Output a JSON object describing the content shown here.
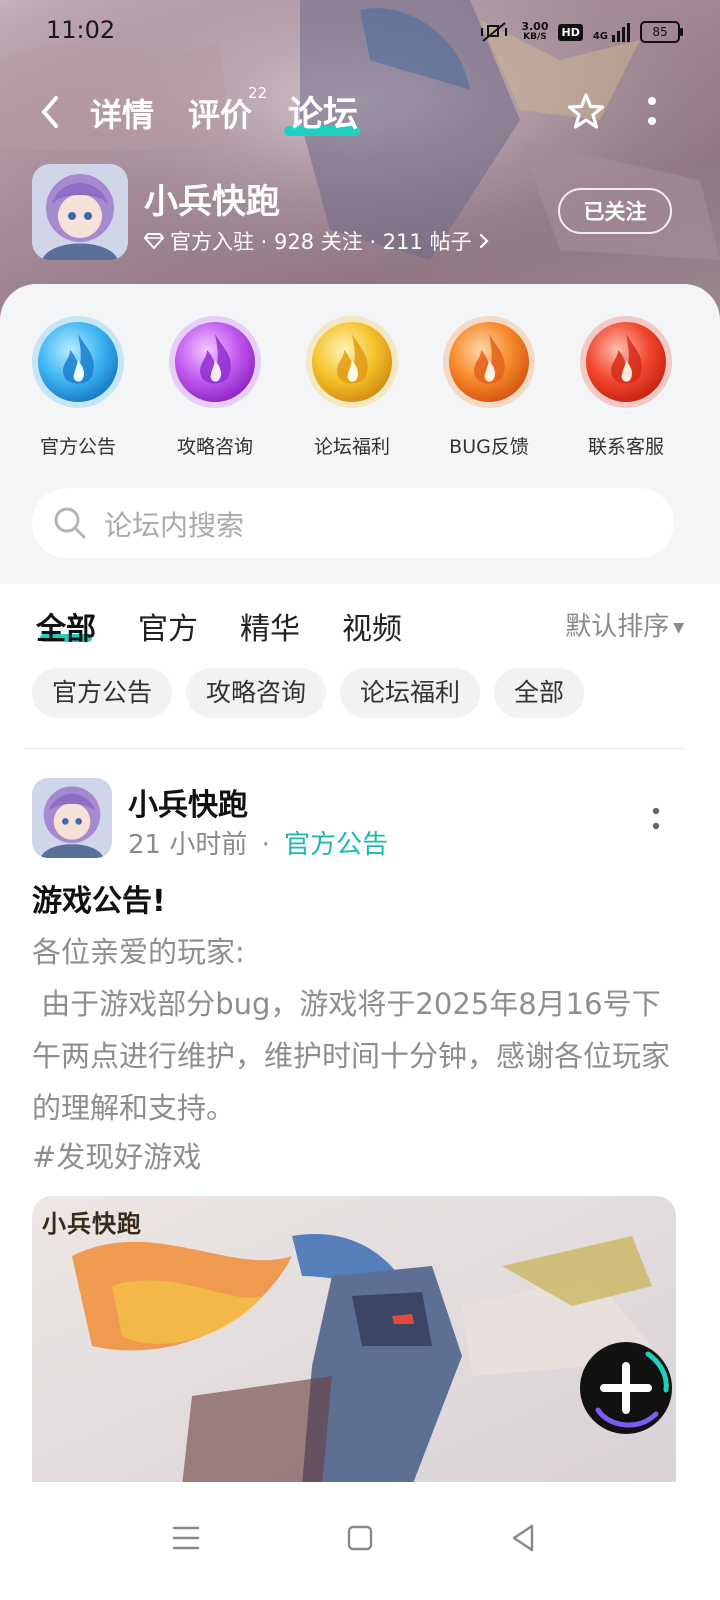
{
  "status_bar": {
    "time": "11:02",
    "net_speed_value": "3.00",
    "net_speed_unit": "KB/S",
    "hd_badge": "HD",
    "network": "4G",
    "battery": "85"
  },
  "nav": {
    "tabs": [
      {
        "label": "详情"
      },
      {
        "label": "评价",
        "badge": "22"
      },
      {
        "label": "论坛",
        "active": true
      }
    ]
  },
  "game": {
    "name": "小兵快跑",
    "meta": "官方入驻 · 928 关注 · 211 帖子",
    "follow_button": "已关注"
  },
  "quick_entries": [
    {
      "label": "官方公告",
      "color": "#3fb6f2"
    },
    {
      "label": "攻略咨询",
      "color": "#c25af0"
    },
    {
      "label": "论坛福利",
      "color": "#f5c22a"
    },
    {
      "label": "BUG反馈",
      "color": "#f7892b"
    },
    {
      "label": "联系客服",
      "color": "#f2472f"
    }
  ],
  "search": {
    "placeholder": "论坛内搜索"
  },
  "filter_tabs": [
    {
      "label": "全部",
      "active": true
    },
    {
      "label": "官方"
    },
    {
      "label": "精华"
    },
    {
      "label": "视频"
    }
  ],
  "sort_label": "默认排序",
  "chips": [
    "官方公告",
    "攻略咨询",
    "论坛福利",
    "全部"
  ],
  "post": {
    "author": "小兵快跑",
    "time": "21 小时前",
    "separator": "·",
    "category": "官方公告",
    "title": "游戏公告!",
    "body_lines": [
      "各位亲爱的玩家:",
      " 由于游戏部分bug，游戏将于2025年8月16号下午两点进行维护，维护时间十分钟，感谢各位玩家的理解和支持。"
    ],
    "hashtag": "#发现好游戏",
    "image_logo": "小兵快跑"
  },
  "colors": {
    "accent": "#1ed0c2",
    "tag_text": "#1cb8ae"
  }
}
